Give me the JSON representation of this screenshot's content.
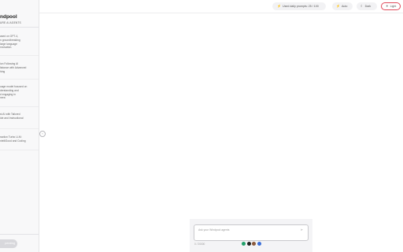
{
  "sidebar": {
    "brand_title": "ndpool",
    "brand_subtitle": "URE AI AGENTS",
    "agents": [
      {
        "label": "ased on GPT-4,\nn groundbreaking\nlarge language\nnnovation."
      },
      {
        "label": "ion Following AI\nlistance with Advanced\nhing"
      },
      {
        "label": "uage model focused on\nderstanding and\nd engaging in\nnera"
      },
      {
        "label": "st AI with Tailored\nide and Instructional"
      },
      {
        "label": "raction Turbo LLM:\nntelliGood and Coding"
      }
    ],
    "status_label": "pending"
  },
  "topbar": {
    "usage_icon": "bolt-icon",
    "usage_label": "Used daily prompts: 25 / 100",
    "auto_label": "Auto",
    "dark_label": "Dark",
    "light_label": "Light"
  },
  "composer": {
    "placeholder": "Ask your Windpool agents",
    "counter": "0 / 20000",
    "model_icons": [
      {
        "name": "model-icon-green",
        "color": "#22a06b"
      },
      {
        "name": "model-icon-dark",
        "color": "#222222"
      },
      {
        "name": "model-icon-brown",
        "color": "#8a5a3c"
      },
      {
        "name": "model-icon-blue",
        "color": "#3b6fd8"
      }
    ]
  }
}
